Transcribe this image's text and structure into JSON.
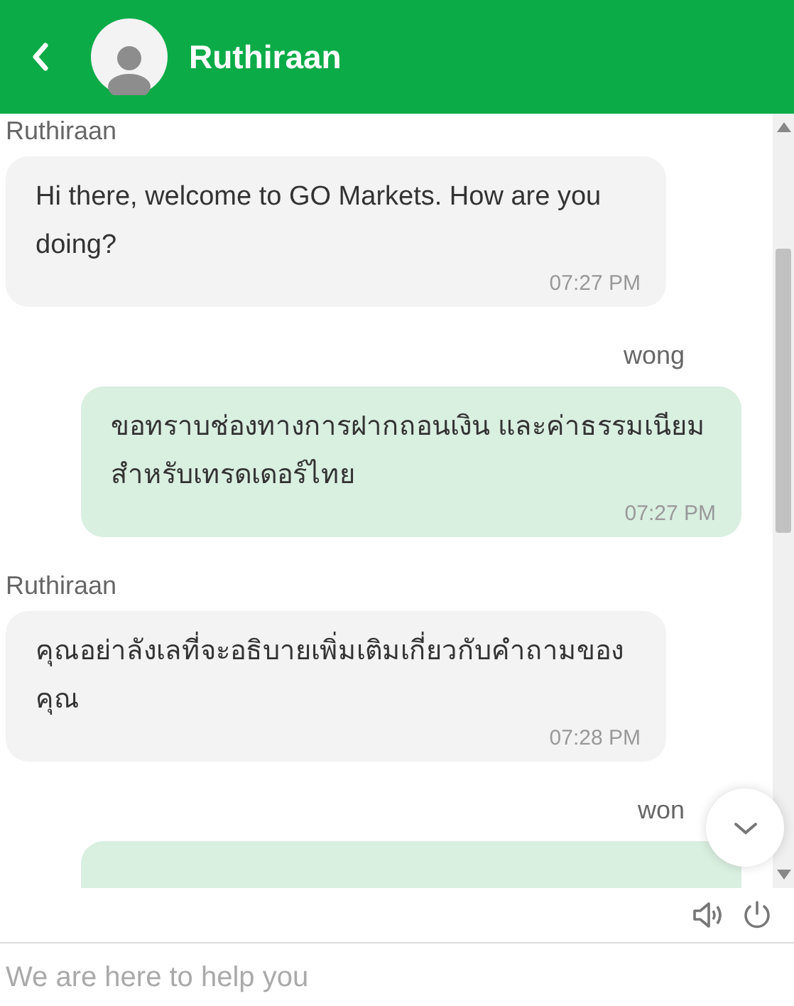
{
  "header": {
    "title": "Ruthiraan"
  },
  "messages": [
    {
      "sender": "Ruthiraan",
      "kind": "incoming",
      "text": "Hi there, welcome to GO Markets. How are you doing?",
      "time": "07:27 PM"
    },
    {
      "sender": "wong",
      "kind": "outgoing",
      "text": "ขอทราบช่องทางการฝากถอนเงิน และค่าธรรมเนียมสำหรับเทรดเดอร์ไทย",
      "time": "07:27 PM"
    },
    {
      "sender": "Ruthiraan",
      "kind": "incoming",
      "text": "คุณอย่าลังเลที่จะอธิบายเพิ่มเติมเกี่ยวกับคำถามของคุณ",
      "time": "07:28 PM"
    },
    {
      "sender": "won",
      "kind": "outgoing"
    }
  ],
  "composer": {
    "placeholder": "We are here to help you"
  }
}
